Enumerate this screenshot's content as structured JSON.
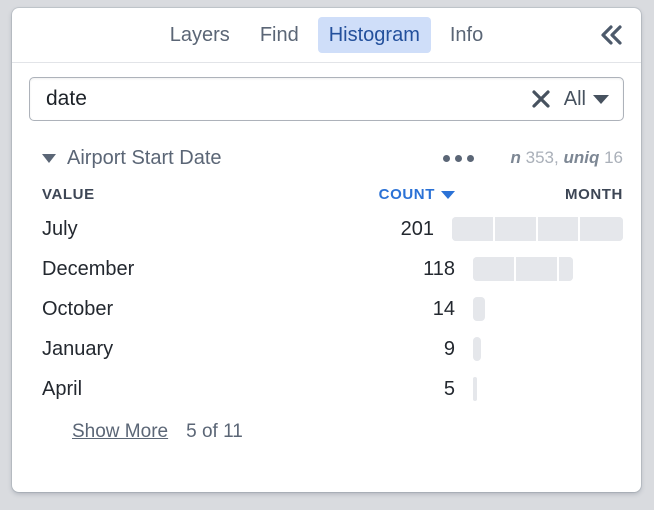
{
  "tabs": [
    {
      "label": "Layers",
      "active": false
    },
    {
      "label": "Find",
      "active": false
    },
    {
      "label": "Histogram",
      "active": true
    },
    {
      "label": "Info",
      "active": false
    }
  ],
  "collapse_icon": "double-chevron-left-icon",
  "search": {
    "value": "date",
    "placeholder": "",
    "clear_icon": "close-x-icon",
    "filter_label": "All",
    "filter_caret_icon": "triangle-down-icon"
  },
  "field": {
    "name": "Airport Start Date",
    "expanded": true,
    "expand_icon": "triangle-down-icon",
    "more_icon": "ellipsis-icon",
    "stats": {
      "n_label": "n",
      "n_value": "353",
      "separator": ",",
      "uniq_label": "uniq",
      "uniq_value": "16"
    }
  },
  "columns": {
    "value": "VALUE",
    "count": "COUNT",
    "month": "MONTH",
    "sorted_by": "COUNT",
    "sort_icon": "triangle-down-icon"
  },
  "footer": {
    "show_more": "Show More",
    "page_count": "5 of 11"
  },
  "colors": {
    "accent_blue": "#2b72d6",
    "active_tab_bg": "#cfdef9",
    "active_tab_text": "#23509c",
    "bar_fill": "#e5e7eb",
    "slate": "#5b6676"
  },
  "chart_data": {
    "type": "bar",
    "title": "Airport Start Date",
    "xlabel": "COUNT",
    "ylabel": "VALUE",
    "categories": [
      "July",
      "December",
      "October",
      "January",
      "April"
    ],
    "values": [
      201,
      118,
      14,
      9,
      5
    ],
    "value_labels": [
      "201",
      "118",
      "14",
      "9",
      "5"
    ],
    "max_value": 201,
    "total_n": 353,
    "unique_values": 16,
    "shown_rows": 5,
    "total_rows": 11,
    "bar_segments": 4,
    "orientation": "horizontal",
    "grid": false,
    "legend": false
  }
}
